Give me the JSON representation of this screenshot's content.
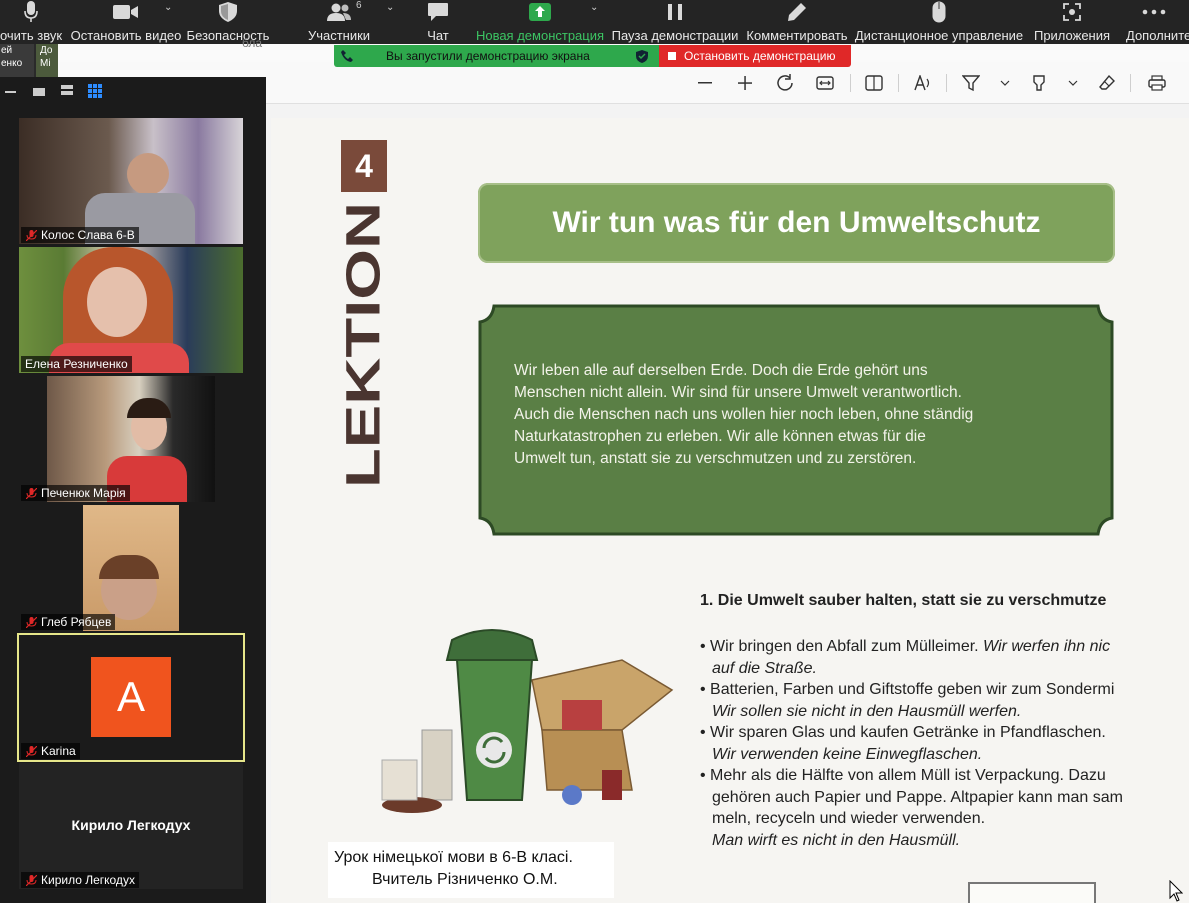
{
  "toolbar": {
    "items": [
      {
        "label": "очить звук",
        "icon": "microphone-icon"
      },
      {
        "label": "Остановить видео",
        "icon": "video-camera-icon"
      },
      {
        "label": "Безопасность",
        "icon": "shield-icon"
      },
      {
        "label": "Участники",
        "icon": "participants-icon",
        "badge": "6"
      },
      {
        "label": "Чат",
        "icon": "chat-icon"
      },
      {
        "label": "Новая демонстрация",
        "icon": "share-screen-icon"
      },
      {
        "label": "Пауза демонстрации",
        "icon": "pause-icon"
      },
      {
        "label": "Комментировать",
        "icon": "pencil-icon"
      },
      {
        "label": "Дистанционное управление",
        "icon": "mouse-icon"
      },
      {
        "label": "Приложения",
        "icon": "apps-icon"
      },
      {
        "label": "Дополните",
        "icon": "more-icon"
      }
    ],
    "accent": "#3cc463"
  },
  "share_banner": {
    "status": "Вы запустили демонстрацию экрана",
    "stop_label": "Остановить демонстрацию"
  },
  "top_left_thumbs": [
    "ей",
    "енко",
    "До",
    "Мі"
  ],
  "pdf_address_fragment": "бла",
  "gallery": {
    "tiles": [
      {
        "name": "Колос Слава 6-В",
        "kind": "video"
      },
      {
        "name": "Елена Резниченко",
        "kind": "video"
      },
      {
        "name": "Печенюк Марія",
        "kind": "video"
      },
      {
        "name": "Глеб Рябцев",
        "kind": "video"
      },
      {
        "name": "Karina",
        "kind": "avatar",
        "avatar_letter": "A",
        "active": true
      },
      {
        "name": "Кирило Легкодух",
        "kind": "name-only",
        "center_name": "Кирило Легкодух"
      }
    ]
  },
  "textbook": {
    "lektion_number": "4",
    "lektion_word": "LEKTION",
    "title": "Wir tun was für den Umweltschutz",
    "intro_lines": [
      "Wir leben alle auf derselben Erde. Doch die Erde gehört uns",
      "Menschen nicht allein. Wir sind für unsere Umwelt verantwortlich.",
      "Auch die Menschen nach uns wollen hier noch leben, ohne ständig",
      "Naturkatastrophen zu erleben. Wir alle können etwas für die",
      "Umwelt tun, anstatt sie zu verschmutzen und zu zerstören."
    ],
    "section_title": "1. Die Umwelt sauber halten, statt sie zu verschmutze",
    "bullets": [
      {
        "text": "Wir bringen den Abfall zum Mülleimer.",
        "italic": " Wir werfen ihn nic",
        "italic2": "auf die Straße."
      },
      {
        "text": "Batterien, Farben und Giftstoffe geben wir zum Sondermi",
        "italic2": "Wir sollen sie nicht in den Hausmüll werfen."
      },
      {
        "text": "Wir sparen Glas und kaufen Getränke in Pfandflaschen.",
        "italic2": "Wir verwenden keine Einwegflaschen."
      },
      {
        "text": "Mehr als die Hälfte von allem Müll ist Verpackung. Dazu",
        "line2": "gehören auch Papier und Pappe. Altpapier kann man sam",
        "line3": "meln, recyceln und wieder verwenden.",
        "italic2": "Man wirft es nicht in den Hausmüll."
      }
    ],
    "green": "#5a7f45"
  },
  "caption": {
    "line1": "Урок німецької мови в 6-В класі.",
    "line2": "Вчитель Різниченко О.М."
  }
}
